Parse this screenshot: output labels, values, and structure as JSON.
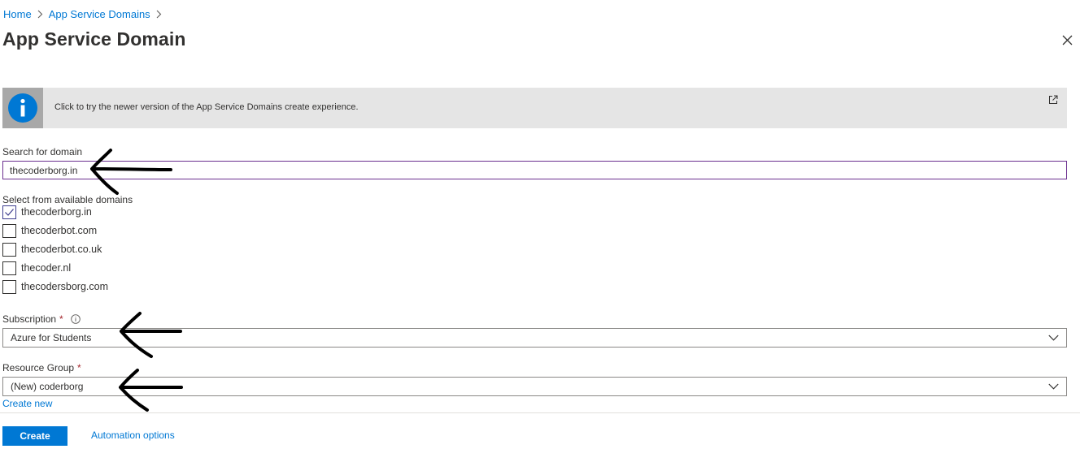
{
  "breadcrumb": {
    "items": [
      "Home",
      "App Service Domains"
    ]
  },
  "page": {
    "title": "App Service Domain"
  },
  "banner": {
    "text": "Click to try the newer version of the App Service Domains create experience."
  },
  "search": {
    "label": "Search for domain",
    "value": "thecoderborg.in"
  },
  "domains": {
    "label": "Select from available domains",
    "items": [
      {
        "name": "thecoderborg.in",
        "checked": true
      },
      {
        "name": "thecoderbot.com",
        "checked": false
      },
      {
        "name": "thecoderbot.co.uk",
        "checked": false
      },
      {
        "name": "thecoder.nl",
        "checked": false
      },
      {
        "name": "thecodersborg.com",
        "checked": false
      }
    ]
  },
  "subscription": {
    "label": "Subscription",
    "required": "*",
    "value": "Azure for Students"
  },
  "resource_group": {
    "label": "Resource Group",
    "required": "*",
    "value": "(New) coderborg",
    "create_new": "Create new"
  },
  "footer": {
    "create_label": "Create",
    "automation_label": "Automation options"
  },
  "colors": {
    "accent": "#0078d4",
    "required": "#a4262c",
    "banner_bg": "#e5e5e5",
    "info_icon": "#0078d4"
  },
  "icons": [
    "chevron-right-icon",
    "close-icon",
    "info-icon",
    "external-link-icon",
    "info-circle-icon",
    "checkmark-icon",
    "chevron-down-icon",
    "arrow-annotation"
  ]
}
